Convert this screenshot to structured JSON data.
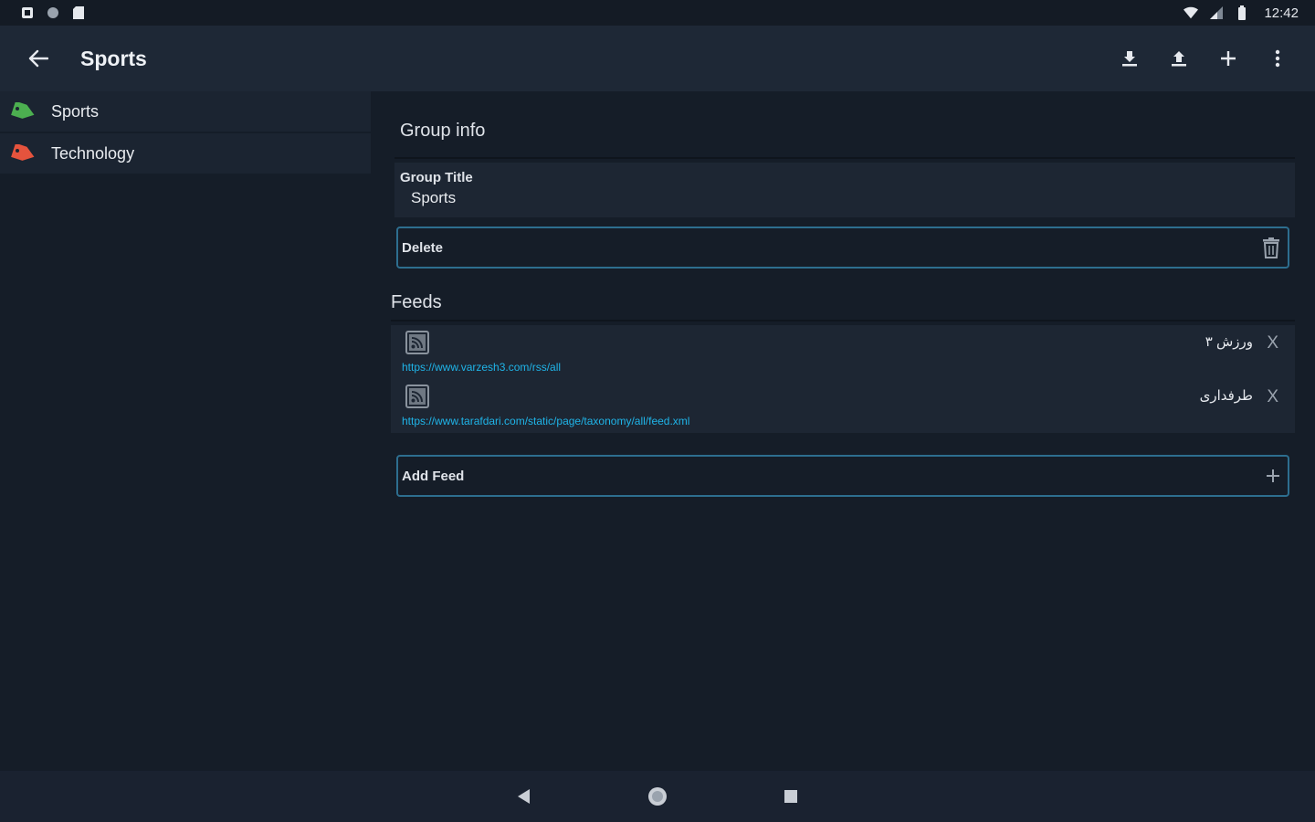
{
  "status_bar": {
    "time": "12:42",
    "left_icons": [
      "notification-a-icon",
      "notification-b-icon",
      "sd-card-icon"
    ],
    "right_icons": [
      "wifi-icon",
      "signal-icon",
      "battery-icon"
    ]
  },
  "app_bar": {
    "title": "Sports",
    "actions": [
      "import-icon",
      "export-icon",
      "add-icon",
      "more-vert-icon"
    ]
  },
  "sidebar": {
    "items": [
      {
        "label": "Sports",
        "tag_color": "#4caf50"
      },
      {
        "label": "Technology",
        "tag_color": "#e5533d"
      }
    ]
  },
  "group_info": {
    "heading": "Group info",
    "title_label": "Group Title",
    "title_value": "Sports",
    "delete_label": "Delete"
  },
  "feeds": {
    "heading": "Feeds",
    "items": [
      {
        "name": "ورزش ۳",
        "url": "https://www.varzesh3.com/rss/all"
      },
      {
        "name": "طرفداری",
        "url": "https://www.tarafdari.com/static/page/taxonomy/all/feed.xml"
      }
    ],
    "add_label": "Add Feed"
  },
  "colors": {
    "background": "#151d28",
    "app_bar": "#1e2836",
    "accent_outline": "#2d6e8f",
    "link": "#1fb4e8"
  }
}
